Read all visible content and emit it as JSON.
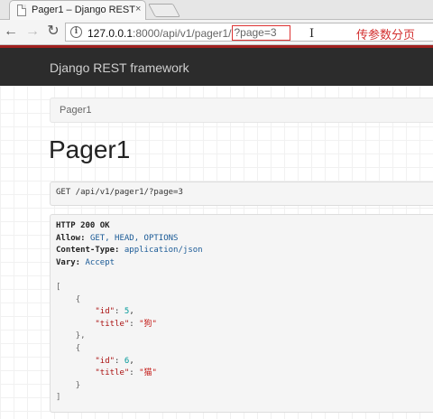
{
  "browser": {
    "tab_title": "Pager1 – Django REST",
    "tab_close": "×",
    "url_host": "127.0.0.1",
    "url_rest": ":8000/api/v1/pager1/",
    "url_query": "?page=3",
    "annotation": "传参数分页"
  },
  "navbar": {
    "brand": "Django REST framework"
  },
  "breadcrumb": {
    "label": "Pager1"
  },
  "page": {
    "title": "Pager1"
  },
  "request": {
    "line": "GET /api/v1/pager1/?page=3"
  },
  "response": {
    "status": "HTTP 200 OK",
    "headers": [
      {
        "name": "Allow:",
        "value": "GET, HEAD, OPTIONS"
      },
      {
        "name": "Content-Type:",
        "value": "application/json"
      },
      {
        "name": "Vary:",
        "value": "Accept"
      }
    ],
    "open_bracket": "[",
    "close_bracket": "]",
    "open_brace": "{",
    "close_brace": "}",
    "close_brace_comma": "},",
    "items": [
      {
        "id_key": "\"id\"",
        "id_val": "5",
        "title_key": "\"title\"",
        "title_val": "\"狗\""
      },
      {
        "id_key": "\"id\"",
        "id_val": "6",
        "title_key": "\"title\"",
        "title_val": "\"猫\""
      }
    ]
  }
}
